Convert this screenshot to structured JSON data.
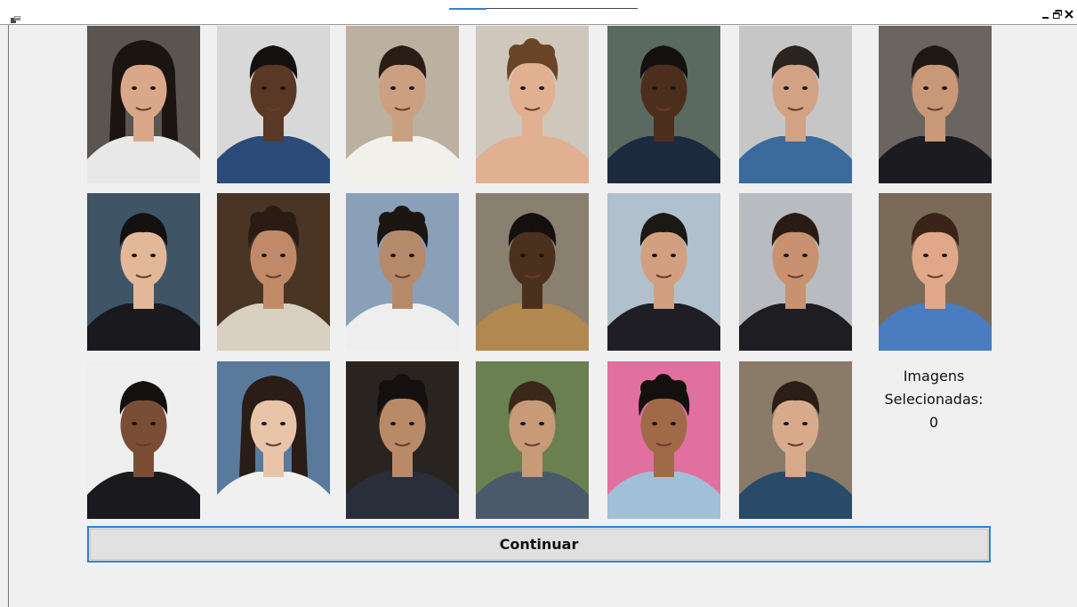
{
  "window": {
    "icons": {
      "app": "app-icon",
      "minimize": "minimize-icon",
      "restore": "restore-icon",
      "close": "close-icon"
    }
  },
  "gallery": {
    "photos": [
      {
        "row": 1,
        "col": 1,
        "bg": "#5a5550",
        "skin": "#d9a88a",
        "hair": "#1c1410",
        "shirt": "#e8e8e8",
        "hair_style": "long"
      },
      {
        "row": 1,
        "col": 2,
        "bg": "#d8d8d8",
        "skin": "#5a3826",
        "hair": "#151010",
        "shirt": "#2b4c78",
        "hair_style": "short"
      },
      {
        "row": 1,
        "col": 3,
        "bg": "#bcb0a0",
        "skin": "#caa080",
        "hair": "#2a1d16",
        "shirt": "#f2f0ea",
        "hair_style": "short"
      },
      {
        "row": 1,
        "col": 4,
        "bg": "#cfc7bb",
        "skin": "#e0b090",
        "hair": "#6a4426",
        "shirt": "#e0b090",
        "hair_style": "curly"
      },
      {
        "row": 1,
        "col": 5,
        "bg": "#5a6a60",
        "skin": "#4b2e1c",
        "hair": "#151010",
        "shirt": "#1c2a40",
        "hair_style": "short"
      },
      {
        "row": 1,
        "col": 6,
        "bg": "#c6c6c6",
        "skin": "#d2a284",
        "hair": "#2a2420",
        "shirt": "#3b6a9c",
        "hair_style": "short"
      },
      {
        "row": 1,
        "col": 7,
        "bg": "#6a6560",
        "skin": "#c89878",
        "hair": "#1e1814",
        "shirt": "#1c1c20",
        "hair_style": "short"
      },
      {
        "row": 2,
        "col": 1,
        "bg": "#3f5566",
        "skin": "#e2b898",
        "hair": "#141010",
        "shirt": "#1a1a1e",
        "hair_style": "short"
      },
      {
        "row": 2,
        "col": 2,
        "bg": "#4a3424",
        "skin": "#c08a68",
        "hair": "#2a1c14",
        "shirt": "#d8d0c0",
        "hair_style": "curly"
      },
      {
        "row": 2,
        "col": 3,
        "bg": "#8aa0b8",
        "skin": "#b58a6a",
        "hair": "#1c1612",
        "shirt": "#eeeeee",
        "hair_style": "curly"
      },
      {
        "row": 2,
        "col": 4,
        "bg": "#8a8070",
        "skin": "#4c301e",
        "hair": "#141010",
        "shirt": "#b08850",
        "hair_style": "short"
      },
      {
        "row": 2,
        "col": 5,
        "bg": "#b0c0cc",
        "skin": "#d2a080",
        "hair": "#1c1814",
        "shirt": "#1e1e24",
        "hair_style": "short"
      },
      {
        "row": 2,
        "col": 6,
        "bg": "#b8bcc0",
        "skin": "#c89270",
        "hair": "#2a1c14",
        "shirt": "#1e1e22",
        "hair_style": "short"
      },
      {
        "row": 2,
        "col": 7,
        "bg": "#7a6a58",
        "skin": "#e0a888",
        "hair": "#3a2418",
        "shirt": "#4a7cc0",
        "hair_style": "short"
      },
      {
        "row": 3,
        "col": 1,
        "bg": "#eeeeee",
        "skin": "#7a4e34",
        "hair": "#141010",
        "shirt": "#1a1a1e",
        "hair_style": "short"
      },
      {
        "row": 3,
        "col": 2,
        "bg": "#5a7a9c",
        "skin": "#e8c4a8",
        "hair": "#2a1c16",
        "shirt": "#f0f0f0",
        "hair_style": "long"
      },
      {
        "row": 3,
        "col": 3,
        "bg": "#2a2420",
        "skin": "#b88a68",
        "hair": "#141010",
        "shirt": "#2a2e3a",
        "hair_style": "curly"
      },
      {
        "row": 3,
        "col": 4,
        "bg": "#6a8050",
        "skin": "#c89a78",
        "hair": "#3a2818",
        "shirt": "#4a5a6a",
        "hair_style": "short"
      },
      {
        "row": 3,
        "col": 5,
        "bg": "#e070a0",
        "skin": "#a06a48",
        "hair": "#141010",
        "shirt": "#a0c0d8",
        "hair_style": "curly"
      },
      {
        "row": 3,
        "col": 6,
        "bg": "#8a7a68",
        "skin": "#d8aa8c",
        "hair": "#2a1e16",
        "shirt": "#2a4a6a",
        "hair_style": "short"
      }
    ]
  },
  "counter": {
    "line1": "Imagens",
    "line2": "Selecionadas:",
    "value": "0"
  },
  "actions": {
    "continue_label": "Continuar"
  },
  "colors": {
    "accent": "#2f7fd6",
    "form_bg": "#f0f0f0",
    "button_bg": "#e1e1e1"
  }
}
